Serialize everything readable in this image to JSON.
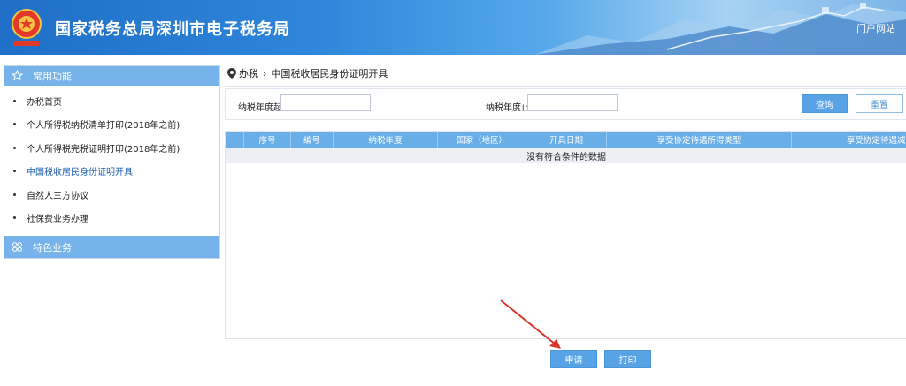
{
  "header": {
    "title": "国家税务总局深圳市电子税务局",
    "portal_link": "门户网站"
  },
  "sidebar": {
    "section_common": "常用功能",
    "items": [
      {
        "label": "办税首页"
      },
      {
        "label": "个人所得税纳税清单打印(2018年之前)"
      },
      {
        "label": "个人所得税完税证明打印(2018年之前)"
      },
      {
        "label": "中国税收居民身份证明开具"
      },
      {
        "label": "自然人三方协议"
      },
      {
        "label": "社保费业务办理"
      }
    ],
    "section_special": "特色业务"
  },
  "breadcrumb": {
    "root": "办税",
    "current": "中国税收居民身份证明开具"
  },
  "filter": {
    "year_from_label": "纳税年度起:",
    "year_from_value": "",
    "year_to_label": "纳税年度止:",
    "year_to_value": "",
    "query_label": "查询",
    "reset_label": "重置"
  },
  "table": {
    "columns": [
      "序号",
      "编号",
      "纳税年度",
      "国家（地区）",
      "开具日期",
      "享受协定待遇所得类型",
      "享受协定待遇减免"
    ],
    "empty_text": "没有符合条件的数据"
  },
  "actions": {
    "apply_label": "申请",
    "print_label": "打印"
  },
  "colors": {
    "accent": "#57a3e6",
    "header_blue": "#2f86da",
    "annotation_arrow": "#d9362b"
  }
}
